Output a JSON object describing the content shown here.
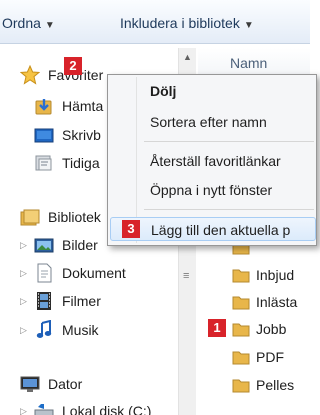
{
  "toolbar": {
    "organize_label": "Ordna",
    "include_label": "Inkludera i bibliotek"
  },
  "nav": {
    "favorites": "Favoriter",
    "downloads": "Hämta",
    "desktop": "Skrivb",
    "recent": "Tidiga",
    "libraries": "Bibliotek",
    "pictures": "Bilder",
    "documents": "Dokument",
    "videos": "Filmer",
    "music": "Musik",
    "computer": "Dator",
    "local_disk": "Lokal disk (C:)"
  },
  "file_list": {
    "column_name": "Namn",
    "items": [
      "Inbjud",
      "Inlästa",
      "Jobb",
      "PDF",
      "Pelles"
    ]
  },
  "context_menu": {
    "items": [
      "Dölj",
      "Sortera efter namn",
      "Återställ favoritlänkar",
      "Öppna i nytt fönster",
      "Lägg till den aktuella p"
    ]
  },
  "callouts": [
    "2",
    "3",
    "1"
  ],
  "colors": {
    "callout_red": "#d8232a",
    "folder_yellow": "#e8b64a",
    "menu_highlight": "#dcebfb",
    "toolbar_text": "#1e395b"
  },
  "icons": {
    "favorites": "star-icon",
    "folder": "folder-icon",
    "library": "library-icon",
    "computer": "computer-icon"
  }
}
